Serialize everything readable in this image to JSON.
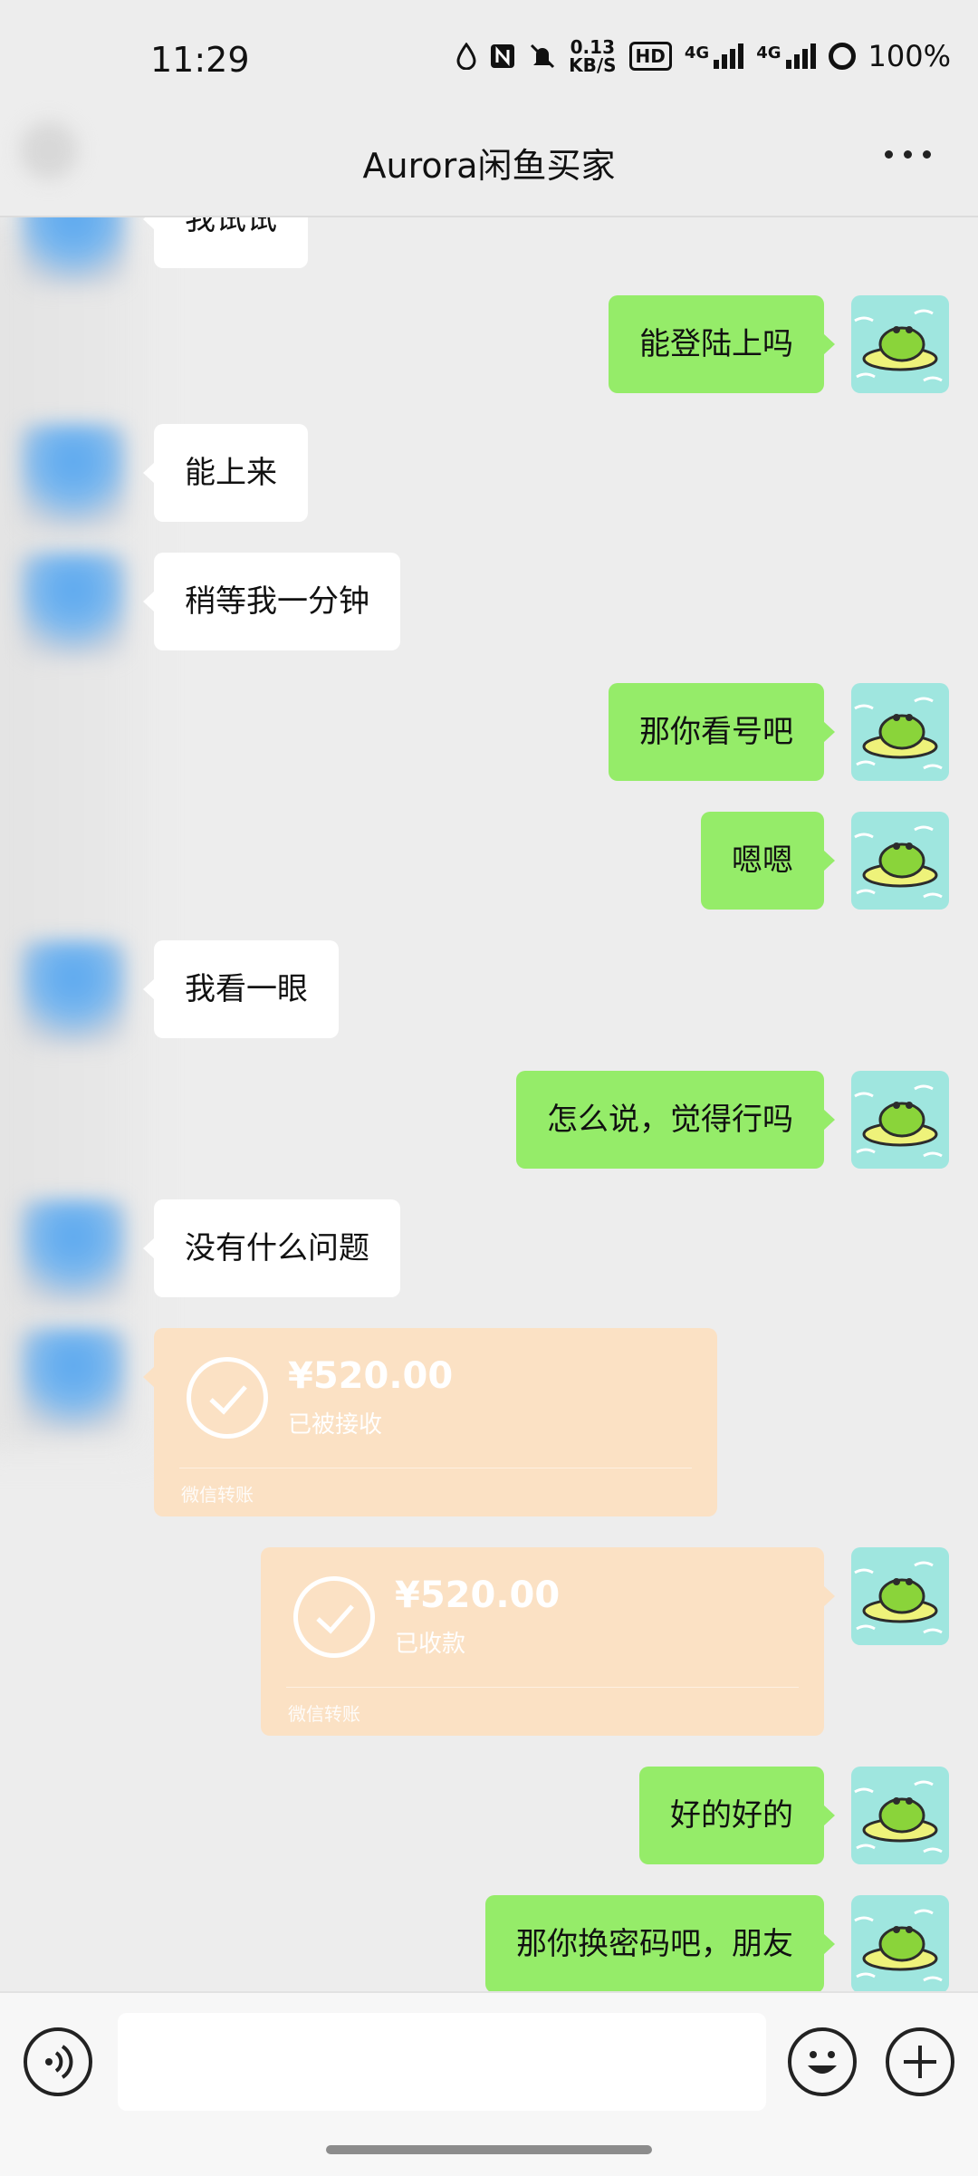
{
  "status_bar": {
    "time": "11:29",
    "net_speed_value": "0.13",
    "net_speed_unit": "KB/S",
    "hd_label": "HD",
    "network_1": "4G",
    "network_2": "4G",
    "battery": "100%",
    "icons": [
      "water-drop-icon",
      "nfc-icon",
      "mute-icon",
      "hd-icon",
      "signal-icon",
      "signal-icon",
      "battery-ring-icon"
    ]
  },
  "header": {
    "title": "Aurora闲鱼买家",
    "more_icon": "more-dots-icon"
  },
  "messages": {
    "m0": "我试试",
    "m1": "能登陆上吗",
    "m2": "能上来",
    "m3": "稍等我一分钟",
    "m4": "那你看号吧",
    "m5": "嗯嗯",
    "m6": "我看一眼",
    "m7": "怎么说，觉得行吗",
    "m8": "没有什么问题",
    "t1": {
      "amount": "¥520.00",
      "status": "已被接收",
      "footer": "微信转账"
    },
    "t2": {
      "amount": "¥520.00",
      "status": "已收款",
      "footer": "微信转账"
    },
    "m9": "好的好的",
    "m10": "那你换密码吧，朋友"
  },
  "input_bar": {
    "input_value": "",
    "icons": [
      "voice-icon",
      "emoji-icon",
      "plus-icon"
    ]
  },
  "colors": {
    "background": "#ededed",
    "out_bubble": "#95ec69",
    "in_bubble": "#ffffff",
    "transfer_card": "#fbe1c4",
    "avatar_bg": "#9fe6df"
  }
}
